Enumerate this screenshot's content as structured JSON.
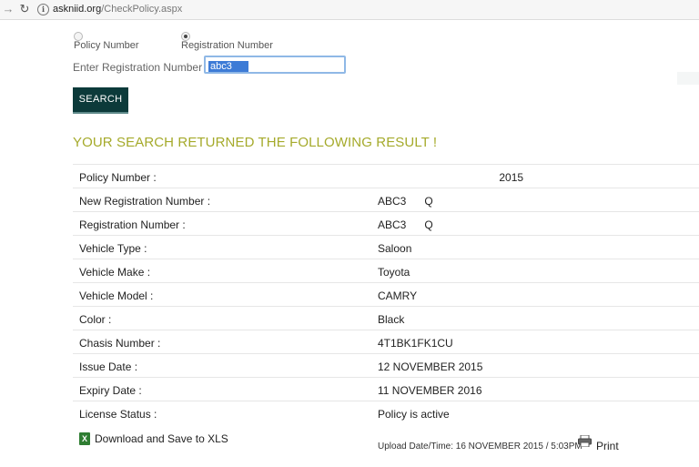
{
  "browser": {
    "url_domain": "askniid.org",
    "url_path": "/CheckPolicy.aspx"
  },
  "search": {
    "option_policy": "Policy Number",
    "option_registration": "Registration Number",
    "selected_option": "Registration Number",
    "field_label": "Enter Registration Number :",
    "field_value": "abc3",
    "button_label": "SEARCH"
  },
  "result": {
    "heading": "YOUR SEARCH RETURNED THE FOLLOWING RESULT !",
    "rows": [
      {
        "label": "Policy Number :",
        "value": "                                        2015"
      },
      {
        "label": "New Registration Number :",
        "value": "ABC3      Q"
      },
      {
        "label": "Registration Number :",
        "value": "ABC3      Q"
      },
      {
        "label": "Vehicle Type :",
        "value": "Saloon"
      },
      {
        "label": "Vehicle Make :",
        "value": "Toyota"
      },
      {
        "label": "Vehicle Model :",
        "value": "CAMRY"
      },
      {
        "label": "Color :",
        "value": "Black"
      },
      {
        "label": "Chasis Number :",
        "value": "4T1BK1FK1CU"
      },
      {
        "label": "Issue Date :",
        "value": "12 NOVEMBER 2015"
      },
      {
        "label": "Expiry Date :",
        "value": "11 NOVEMBER 2016"
      },
      {
        "label": "License Status :",
        "value": "Policy is active"
      }
    ]
  },
  "footer": {
    "download_label": "Download and Save to XLS",
    "upload_info": "Upload Date/Time: 16 NOVEMBER 2015 / 5:03PM",
    "print_label": "Print"
  },
  "colors": {
    "heading": "#a5aa2b",
    "search_button_bg": "#0c3a3a",
    "selection": "#3d7bd6",
    "input_focus_border": "#8fb8e6"
  },
  "icons": {
    "back": "arrow-left-icon",
    "reload": "reload-icon",
    "site_info": "info-icon",
    "excel": "excel-icon",
    "print": "printer-icon"
  }
}
